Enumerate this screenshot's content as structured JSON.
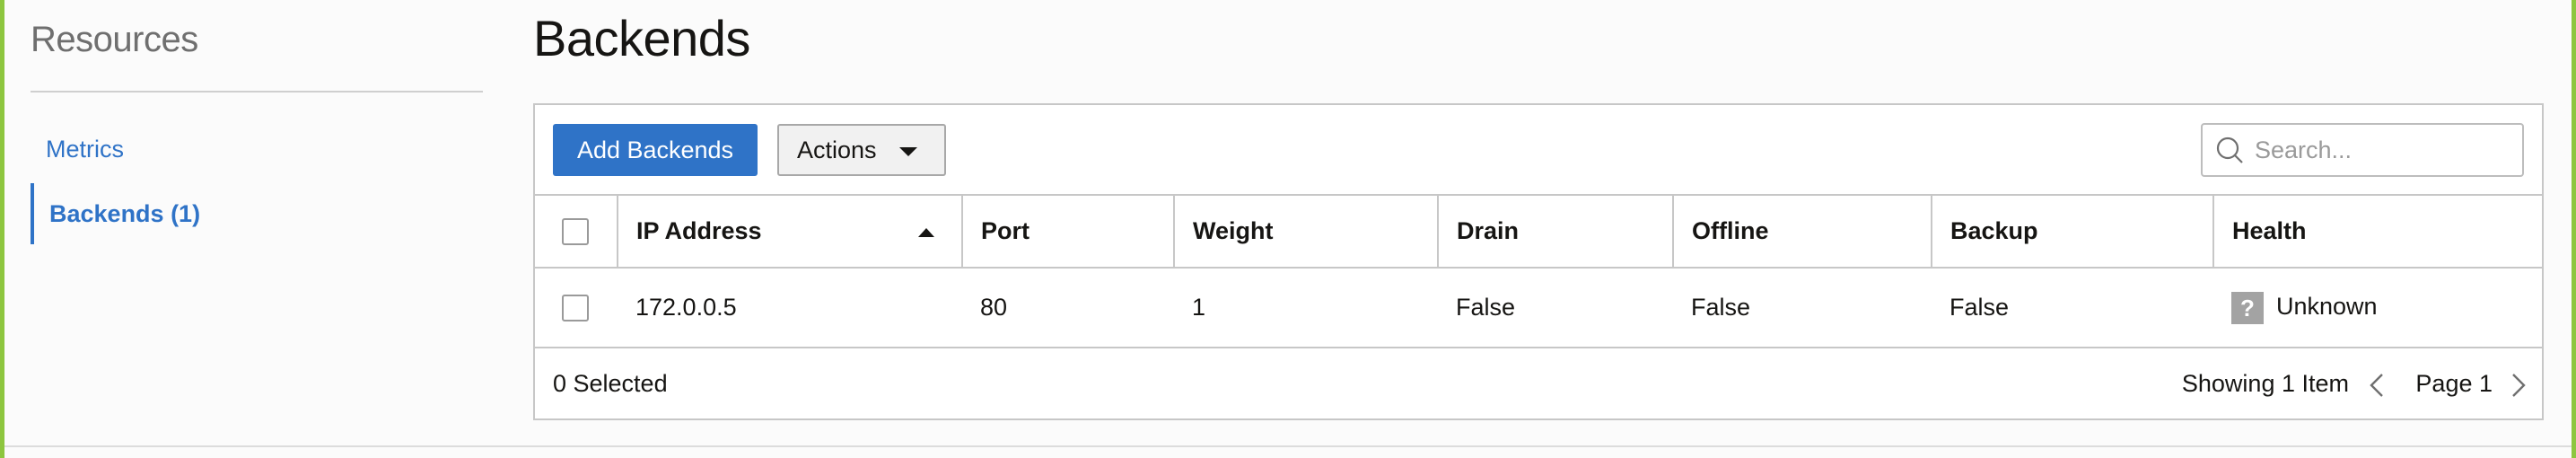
{
  "sidebar": {
    "title": "Resources",
    "items": [
      {
        "label": "Metrics",
        "active": false
      },
      {
        "label": "Backends (1)",
        "active": true
      }
    ]
  },
  "main": {
    "title": "Backends",
    "toolbar": {
      "add_label": "Add Backends",
      "actions_label": "Actions",
      "search_placeholder": "Search...",
      "search_value": ""
    },
    "table": {
      "columns": [
        "IP Address",
        "Port",
        "Weight",
        "Drain",
        "Offline",
        "Backup",
        "Health"
      ],
      "sort_column": "IP Address",
      "sort_direction": "ascending",
      "rows": [
        {
          "ip": "172.0.0.5",
          "port": "80",
          "weight": "1",
          "drain": "False",
          "offline": "False",
          "backup": "False",
          "health": "Unknown",
          "health_icon": "question-icon"
        }
      ]
    },
    "footer": {
      "selected": "0 Selected",
      "showing": "Showing 1 Item",
      "page": "Page 1"
    }
  },
  "colors": {
    "accent": "#2f73c7",
    "frame": "#8dc63f",
    "health_unknown": "#a3a3a3"
  }
}
